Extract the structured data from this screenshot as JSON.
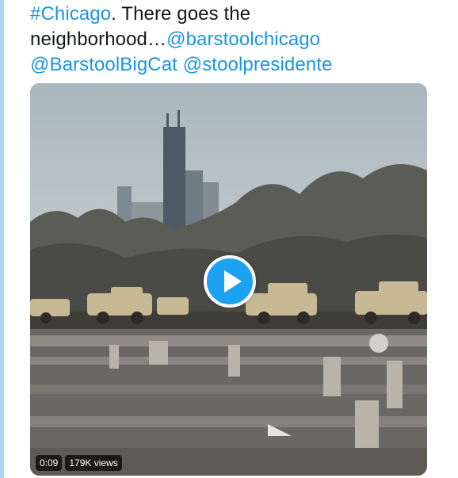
{
  "tweet": {
    "hashtag": "#Chicago",
    "text_1": ". There goes the",
    "text_2": "neighborhood…",
    "mention_1": "@barstoolchicago",
    "mention_2": "@BarstoolBigCat",
    "mention_3": "@stoolpresidente"
  },
  "video": {
    "duration": "0:09",
    "views": "179K views",
    "play_icon": "play-icon"
  },
  "colors": {
    "link": "#1b95e0",
    "play_button": "#1da1f2",
    "thread_line": "#a8d8f4"
  }
}
